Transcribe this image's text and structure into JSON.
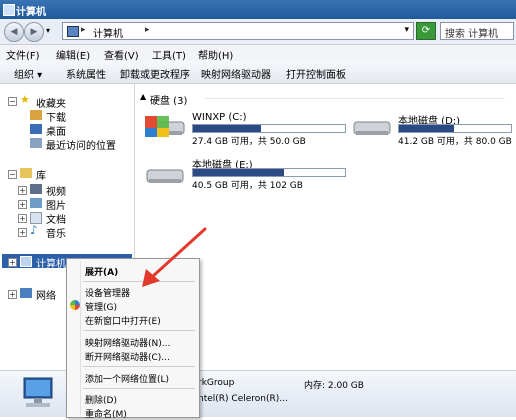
{
  "window": {
    "title": "计算机"
  },
  "address": {
    "crumb": "计算机",
    "search_placeholder": "搜索 计算机"
  },
  "menu": [
    "文件(F)",
    "编辑(E)",
    "查看(V)",
    "工具(T)",
    "帮助(H)"
  ],
  "toolbar": [
    "组织 ▾",
    "系统属性",
    "卸载或更改程序",
    "映射网络驱动器",
    "打开控制面板"
  ],
  "nav": {
    "favorites": "收藏夹",
    "downloads": "下载",
    "desktop": "桌面",
    "recent": "最近访问的位置",
    "libraries": "库",
    "videos": "视频",
    "pictures": "图片",
    "documents": "文档",
    "music": "音乐",
    "computer": "计算机",
    "network": "网络"
  },
  "group": {
    "label": "硬盘 (3)"
  },
  "drives": [
    {
      "name": "WINXP (C:)",
      "info": "27.4 GB 可用，共 50.0 GB",
      "used_fraction": 0.45
    },
    {
      "name": "本地磁盘 (D:)",
      "info": "41.2 GB 可用，共 80.0 GB",
      "used_fraction": 0.49
    },
    {
      "name": "本地磁盘 (E:)",
      "info": "40.5 GB 可用，共 102 GB",
      "used_fraction": 0.6
    }
  ],
  "status": {
    "workgroup": "rkGroup",
    "memory": "内存: 2.00 GB",
    "cpu": "ntel(R) Celeron(R)..."
  },
  "context_menu": {
    "expand": "展开(A)",
    "device_manager": "设备管理器",
    "manage": "管理(G)",
    "open_new": "在新窗口中打开(E)",
    "map_drive": "映射网络驱动器(N)...",
    "disconnect": "断开网络驱动器(C)...",
    "add_location": "添加一个网络位置(L)",
    "delete": "删除(D)",
    "rename": "重命名(M)"
  },
  "colors": {
    "accent": "#2b5fa8",
    "usage_bar": "#2b4a86",
    "arrow": "#e23a2a"
  }
}
